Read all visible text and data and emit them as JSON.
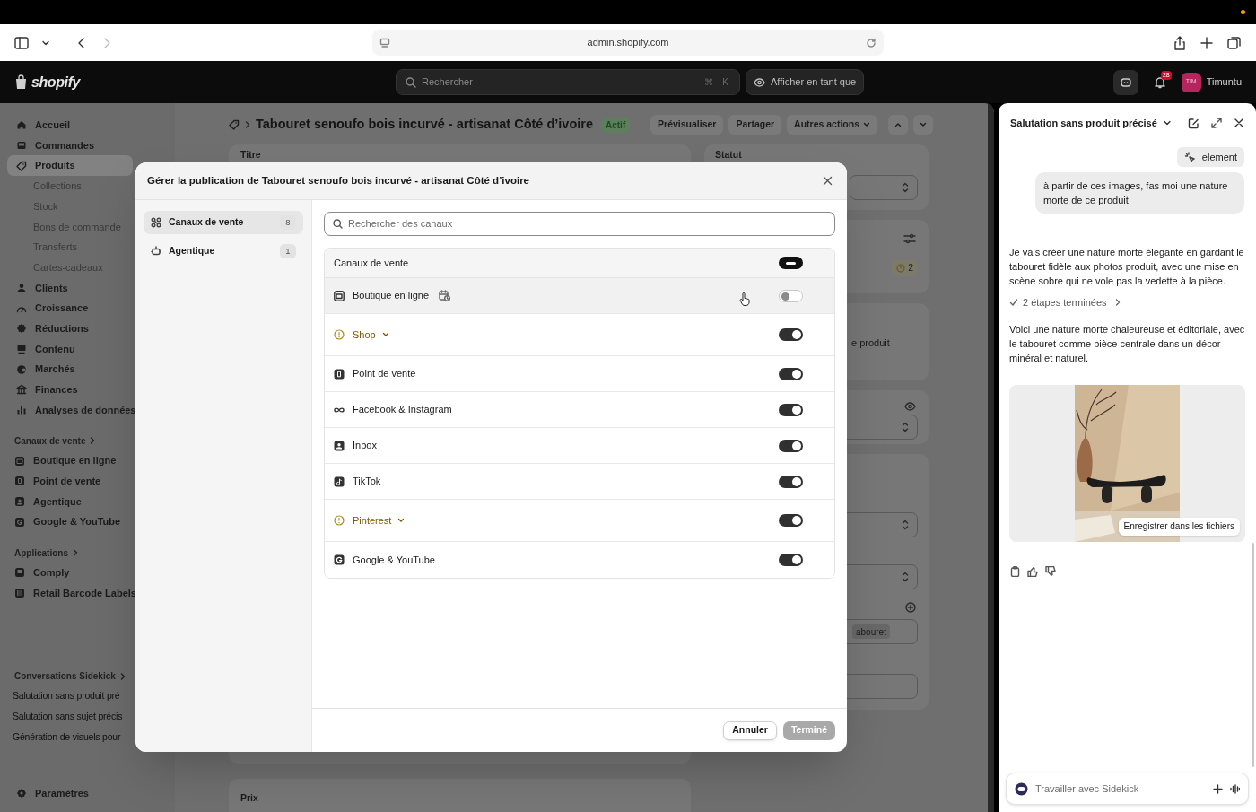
{
  "browser": {
    "url": "admin.shopify.com"
  },
  "topbar": {
    "logo": "shopify",
    "search": {
      "placeholder": "Rechercher",
      "shortcut": [
        "⌘",
        "K"
      ]
    },
    "view_as": "Afficher en tant que",
    "notifications": "28",
    "user": {
      "initials": "TIM",
      "name": "Timuntu"
    }
  },
  "sidebar": {
    "items": [
      {
        "label": "Accueil",
        "selected": false
      },
      {
        "label": "Commandes",
        "selected": false
      },
      {
        "label": "Produits",
        "selected": true,
        "children": [
          {
            "label": "Collections"
          },
          {
            "label": "Stock"
          },
          {
            "label": "Bons de commande"
          },
          {
            "label": "Transferts"
          },
          {
            "label": "Cartes-cadeaux"
          }
        ]
      },
      {
        "label": "Clients",
        "selected": false
      },
      {
        "label": "Croissance",
        "selected": false
      },
      {
        "label": "Réductions",
        "selected": false
      },
      {
        "label": "Contenu",
        "selected": false
      },
      {
        "label": "Marchés",
        "selected": false
      },
      {
        "label": "Finances",
        "selected": false
      },
      {
        "label": "Analyses de données",
        "selected": false
      }
    ],
    "sections": [
      {
        "title": "Canaux de vente",
        "items": [
          {
            "label": "Boutique en ligne"
          },
          {
            "label": "Point de vente"
          },
          {
            "label": "Agentique"
          },
          {
            "label": "Google & YouTube"
          }
        ]
      },
      {
        "title": "Applications",
        "items": [
          {
            "label": "Comply"
          },
          {
            "label": "Retail Barcode Labels"
          }
        ]
      }
    ],
    "conversations": {
      "title": "Conversations Sidekick",
      "items": [
        "Salutation sans produit pré",
        "Salutation sans sujet précis",
        "Génération de visuels pour"
      ]
    },
    "settings": "Paramètres"
  },
  "page": {
    "title": "Tabouret senoufo bois incurvé - artisanat Côté d’ivoire",
    "status": "Actif",
    "actions": [
      "Prévisualiser",
      "Partager",
      "Autres actions"
    ],
    "fragments": {
      "title_label": "Titre",
      "status_label": "Statut",
      "issues_count": "2",
      "text_cut": "e produit",
      "tag_cut": "abouret",
      "price_label": "Prix"
    }
  },
  "modal": {
    "title": "Gérer la publication de Tabouret senoufo bois incurvé - artisanat Côté d’ivoire",
    "nav": [
      {
        "label": "Canaux de vente",
        "count": "8",
        "selected": true
      },
      {
        "label": "Agentique",
        "count": "1",
        "selected": false
      }
    ],
    "search": {
      "placeholder": "Rechercher des canaux"
    },
    "group": {
      "label": "Canaux de vente",
      "indeterminate": true
    },
    "channels": [
      {
        "label": "Boutique en ligne",
        "on": false,
        "warning": false,
        "scheduled": true,
        "highlighted": true
      },
      {
        "label": "Shop",
        "on": true,
        "warning": true,
        "scheduled": false,
        "highlighted": false
      },
      {
        "label": "Point de vente",
        "on": true,
        "warning": false,
        "scheduled": false,
        "highlighted": false
      },
      {
        "label": "Facebook & Instagram",
        "on": true,
        "warning": false,
        "scheduled": false,
        "highlighted": false
      },
      {
        "label": "Inbox",
        "on": true,
        "warning": false,
        "scheduled": false,
        "highlighted": false
      },
      {
        "label": "TikTok",
        "on": true,
        "warning": false,
        "scheduled": false,
        "highlighted": false
      },
      {
        "label": "Pinterest",
        "on": true,
        "warning": true,
        "scheduled": false,
        "highlighted": false
      },
      {
        "label": "Google & YouTube",
        "on": true,
        "warning": false,
        "scheduled": false,
        "highlighted": false
      }
    ],
    "buttons": [
      {
        "label": "Annuler",
        "disabled": false
      },
      {
        "label": "Terminé",
        "disabled": true
      }
    ]
  },
  "sidekick": {
    "title": "Salutation sans produit précisé",
    "chip": "element",
    "user_message": "à partir de ces images, fas moi une nature morte de ce produit",
    "reply_1": "Je vais créer une nature morte élégante en gardant le tabouret fidèle aux photos produit, avec une mise en scène sobre qui ne vole pas la vedette à la pièce.",
    "steps": "2 étapes terminées",
    "reply_2": "Voici une nature morte chaleureuse et éditoriale, avec le tabouret comme pièce centrale dans un décor minéral et naturel.",
    "image": {
      "kind": "picture",
      "action": "Enregistrer dans les fichiers"
    },
    "input": {
      "placeholder": "Travailler avec Sidekick"
    }
  }
}
